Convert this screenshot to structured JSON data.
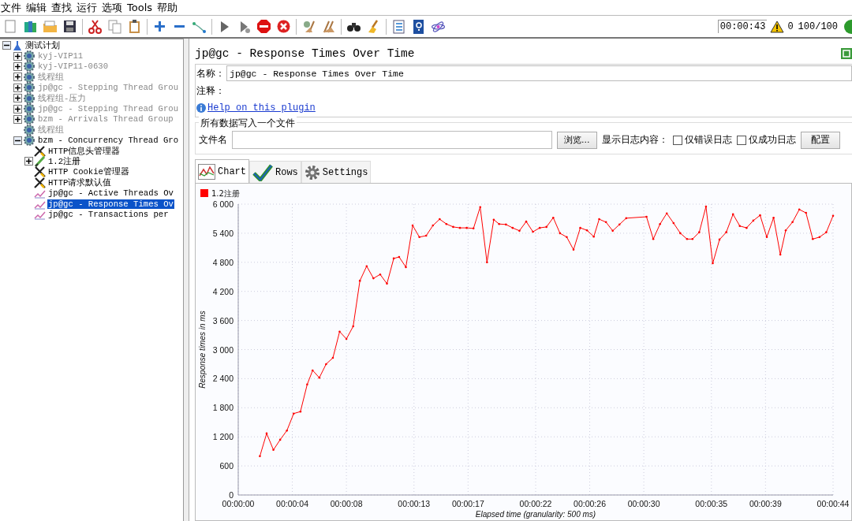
{
  "menu": [
    "文件",
    "编辑",
    "查找",
    "运行",
    "选项",
    "Tools",
    "帮助"
  ],
  "status": {
    "timer": "00:00:43",
    "errors": "0",
    "threads": "100/100"
  },
  "tree": [
    {
      "label": "测试计划",
      "kind": "plan",
      "disabled": false,
      "selected": false,
      "expandable": true,
      "expanded": true,
      "children": [
        {
          "label": "kyj-VIP11",
          "kind": "group",
          "disabled": true,
          "selected": false,
          "expandable": true,
          "expanded": false
        },
        {
          "label": "kyj-VIP11-0630",
          "kind": "group",
          "disabled": true,
          "selected": false,
          "expandable": true,
          "expanded": false
        },
        {
          "label": "线程组",
          "kind": "group",
          "disabled": true,
          "selected": false,
          "expandable": true,
          "expanded": false
        },
        {
          "label": "jp@gc - Stepping Thread Grou",
          "kind": "group",
          "disabled": true,
          "selected": false,
          "expandable": true,
          "expanded": false
        },
        {
          "label": "线程组-压力",
          "kind": "group",
          "disabled": true,
          "selected": false,
          "expandable": true,
          "expanded": false
        },
        {
          "label": "jp@gc - Stepping Thread Grou",
          "kind": "group",
          "disabled": true,
          "selected": false,
          "expandable": true,
          "expanded": false
        },
        {
          "label": "bzm - Arrivals Thread Group",
          "kind": "group",
          "disabled": true,
          "selected": false,
          "expandable": true,
          "expanded": false
        },
        {
          "label": "线程组",
          "kind": "group",
          "disabled": true,
          "selected": false,
          "expandable": false
        },
        {
          "label": "bzm - Concurrency Thread Gro",
          "kind": "group",
          "disabled": false,
          "selected": false,
          "expandable": true,
          "expanded": true,
          "children": [
            {
              "label": "HTTP信息头管理器",
              "kind": "config",
              "disabled": false,
              "selected": false,
              "expandable": false
            },
            {
              "label": "1.2注册",
              "kind": "sampler",
              "disabled": false,
              "selected": false,
              "expandable": true,
              "expanded": false
            },
            {
              "label": "HTTP Cookie管理器",
              "kind": "config",
              "disabled": false,
              "selected": false,
              "expandable": false
            },
            {
              "label": "HTTP请求默认值",
              "kind": "config",
              "disabled": false,
              "selected": false,
              "expandable": false
            },
            {
              "label": "jp@gc - Active Threads Ov",
              "kind": "listener",
              "disabled": false,
              "selected": false,
              "expandable": false
            },
            {
              "label": "jp@gc - Response Times Ov",
              "kind": "listener",
              "disabled": false,
              "selected": true,
              "expandable": false
            },
            {
              "label": "jp@gc - Transactions per",
              "kind": "listener",
              "disabled": false,
              "selected": false,
              "expandable": false
            }
          ]
        }
      ]
    }
  ],
  "panel": {
    "title": "jp@gc - Response Times Over Time",
    "name_label": "名称：",
    "name_value": "jp@gc - Response Times Over Time",
    "comment_label": "注释：",
    "help_link": "Help on this plugin",
    "file_group": "所有数据写入一个文件",
    "file_label": "文件名",
    "browse": "浏览...",
    "log_label": "显示日志内容：",
    "checks": [
      {
        "label": "仅错误日志",
        "checked": false
      },
      {
        "label": "仅成功日志",
        "checked": false
      }
    ],
    "config": "配置"
  },
  "tabs": [
    {
      "label": "Chart",
      "selected": true
    },
    {
      "label": "Rows",
      "selected": false
    },
    {
      "label": "Settings",
      "selected": false
    }
  ],
  "chart_data": {
    "type": "line",
    "grid": true,
    "xlabel": "Elapsed time (granularity: 500 ms)",
    "ylabel": "Response times in ms",
    "xlim": [
      0,
      44
    ],
    "ylim": [
      0,
      6000
    ],
    "xticks": [
      {
        "value": 0,
        "label": "00:00:00"
      },
      {
        "value": 4,
        "label": "00:00:04"
      },
      {
        "value": 8,
        "label": "00:00:08"
      },
      {
        "value": 13,
        "label": "00:00:13"
      },
      {
        "value": 17,
        "label": "00:00:17"
      },
      {
        "value": 22,
        "label": "00:00:22"
      },
      {
        "value": 26,
        "label": "00:00:26"
      },
      {
        "value": 30,
        "label": "00:00:30"
      },
      {
        "value": 35,
        "label": "00:00:35"
      },
      {
        "value": 39,
        "label": "00:00:39"
      },
      {
        "value": 44,
        "label": "00:00:44"
      }
    ],
    "yticks": [
      {
        "value": 0,
        "label": "0"
      },
      {
        "value": 600,
        "label": "600"
      },
      {
        "value": 1200,
        "label": "1 200"
      },
      {
        "value": 1800,
        "label": "1 800"
      },
      {
        "value": 2400,
        "label": "2 400"
      },
      {
        "value": 3000,
        "label": "3 000"
      },
      {
        "value": 3600,
        "label": "3 600"
      },
      {
        "value": 4200,
        "label": "4 200"
      },
      {
        "value": 4800,
        "label": "4 800"
      },
      {
        "value": 5400,
        "label": "5 400"
      },
      {
        "value": 6000,
        "label": "6 000"
      }
    ],
    "x": [
      1.6,
      2.1,
      2.6,
      3.1,
      3.6,
      4.1,
      4.6,
      5.1,
      5.5,
      6.0,
      6.5,
      7.0,
      7.5,
      8.0,
      8.5,
      9.0,
      9.5,
      10.0,
      10.5,
      11.0,
      11.5,
      11.9,
      12.4,
      12.9,
      13.4,
      13.9,
      14.4,
      14.9,
      15.4,
      15.9,
      16.4,
      16.9,
      17.4,
      17.9,
      18.4,
      18.9,
      19.3,
      19.8,
      20.3,
      20.8,
      21.3,
      21.8,
      22.3,
      22.8,
      23.3,
      23.8,
      24.3,
      24.8,
      25.3,
      25.8,
      26.3,
      26.7,
      27.2,
      27.7,
      28.2,
      28.7,
      30.2,
      30.7,
      31.2,
      31.7,
      32.2,
      32.7,
      33.2,
      33.6,
      34.1,
      34.6,
      35.1,
      35.6,
      36.1,
      36.6,
      37.1,
      37.6,
      38.1,
      38.6,
      39.1,
      39.6,
      40.1,
      40.5,
      41.0,
      41.5,
      42.0,
      42.5,
      43.0,
      43.5,
      44.0
    ],
    "series": [
      {
        "name": "1.2注册",
        "color": "#ff0000",
        "values": [
          800,
          1270,
          930,
          1140,
          1330,
          1680,
          1720,
          2280,
          2570,
          2420,
          2700,
          2830,
          3370,
          3220,
          3480,
          4420,
          4720,
          4470,
          4550,
          4360,
          4880,
          4910,
          4700,
          5560,
          5320,
          5350,
          5560,
          5690,
          5590,
          5530,
          5510,
          5510,
          5500,
          5940,
          4800,
          5680,
          5590,
          5580,
          5510,
          5450,
          5640,
          5430,
          5510,
          5530,
          5720,
          5400,
          5320,
          5060,
          5510,
          5460,
          5330,
          5690,
          5630,
          5450,
          5580,
          5710,
          5740,
          5280,
          5590,
          5810,
          5610,
          5400,
          5280,
          5280,
          5420,
          5950,
          4780,
          5270,
          5420,
          5790,
          5550,
          5510,
          5660,
          5770,
          5320,
          5720,
          4960,
          5460,
          5630,
          5890,
          5820,
          5280,
          5320,
          5420,
          5760
        ]
      }
    ]
  }
}
